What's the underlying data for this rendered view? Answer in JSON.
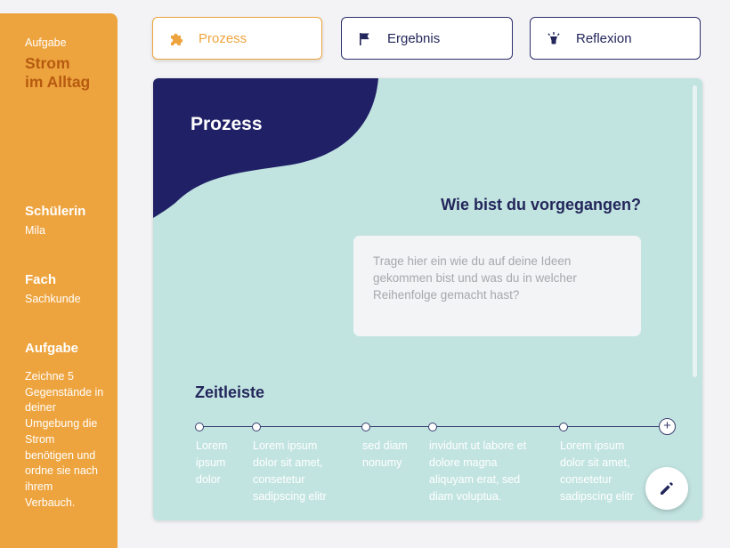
{
  "sidebar": {
    "assignment_label": "Aufgabe",
    "assignment_title_line1": "Strom",
    "assignment_title_line2": "im Alltag",
    "student_heading": "Schülerin",
    "student_name": "Mila",
    "subject_heading": "Fach",
    "subject_name": "Sachkunde",
    "task_heading": "Aufgabe",
    "task_description": "Zeichne 5 Gegenstände in deiner Umgebung die Strom benötigen und ordne sie nach ihrem Verbauch."
  },
  "tabs": [
    {
      "label": "Prozess",
      "icon": "puzzle-icon",
      "active": true
    },
    {
      "label": "Ergebnis",
      "icon": "flag-icon",
      "active": false
    },
    {
      "label": "Reflexion",
      "icon": "lightbulb-icon",
      "active": false
    }
  ],
  "card": {
    "title": "Prozess",
    "question": "Wie bist du vorgegangen?",
    "answer_placeholder": "Trage hier ein wie du auf deine Ideen gekommen bist und was du in welcher Reihenfolge gemacht hast?",
    "timeline_title": "Zeitleiste",
    "timeline": [
      {
        "text": "Lorem ipsum dolor"
      },
      {
        "text": "Lorem ipsum dolor sit amet, consetetur sadipscing elitr"
      },
      {
        "text": "sed diam nonumy"
      },
      {
        "text": "invidunt ut labore et dolore magna aliquyam erat, sed diam voluptua."
      },
      {
        "text": "Lorem ipsum dolor sit amet, consetetur sadipscing elitr"
      }
    ],
    "add_label": "+",
    "edit_icon": "pencil-icon"
  },
  "colors": {
    "sidebar": "#eea43e",
    "accent_dark": "#b65a10",
    "navy": "#23265a",
    "card_bg": "#c2e4e1"
  }
}
